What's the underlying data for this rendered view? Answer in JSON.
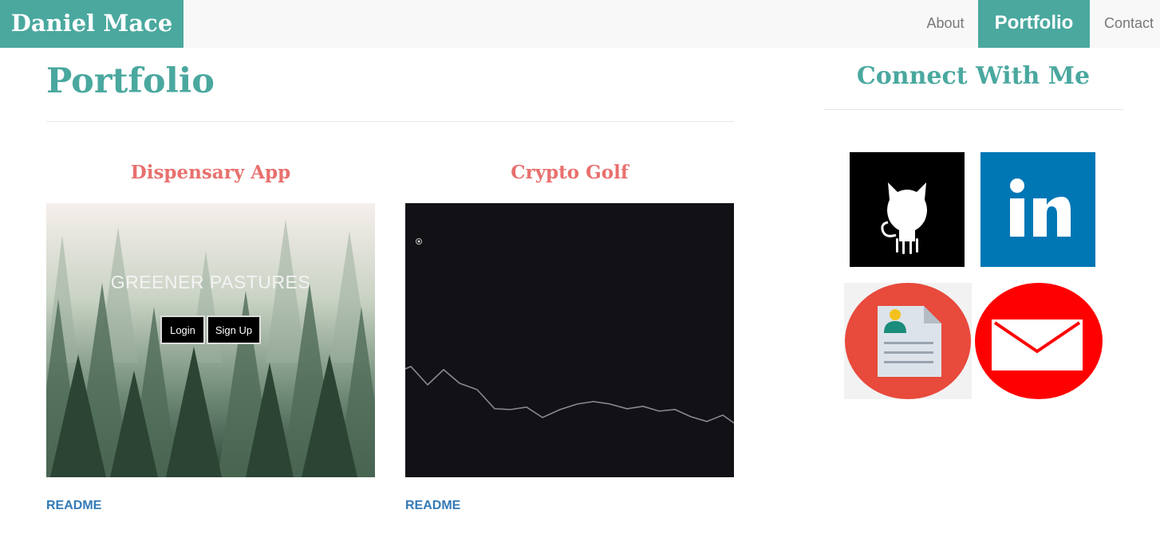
{
  "header": {
    "brand": "Daniel Mace",
    "nav": [
      {
        "label": "About",
        "active": false
      },
      {
        "label": "Portfolio",
        "active": true
      },
      {
        "label": "Contact",
        "active": false
      }
    ]
  },
  "main": {
    "title": "Portfolio",
    "projects": [
      {
        "title": "Dispensary App",
        "preview": {
          "headline": "GREENER PASTURES",
          "buttons": [
            "Login",
            "Sign Up"
          ]
        },
        "link_label": "README"
      },
      {
        "title": "Crypto Golf",
        "link_label": "README"
      }
    ]
  },
  "sidebar": {
    "title": "Connect With Me",
    "links": [
      {
        "icon": "github-icon"
      },
      {
        "icon": "linkedin-icon"
      },
      {
        "icon": "resume-icon"
      },
      {
        "icon": "email-icon"
      }
    ]
  },
  "colors": {
    "accent": "#4aa89f",
    "project_title": "#e8706d",
    "link": "#337ab7",
    "navbar_bg": "#f8f8f8"
  }
}
